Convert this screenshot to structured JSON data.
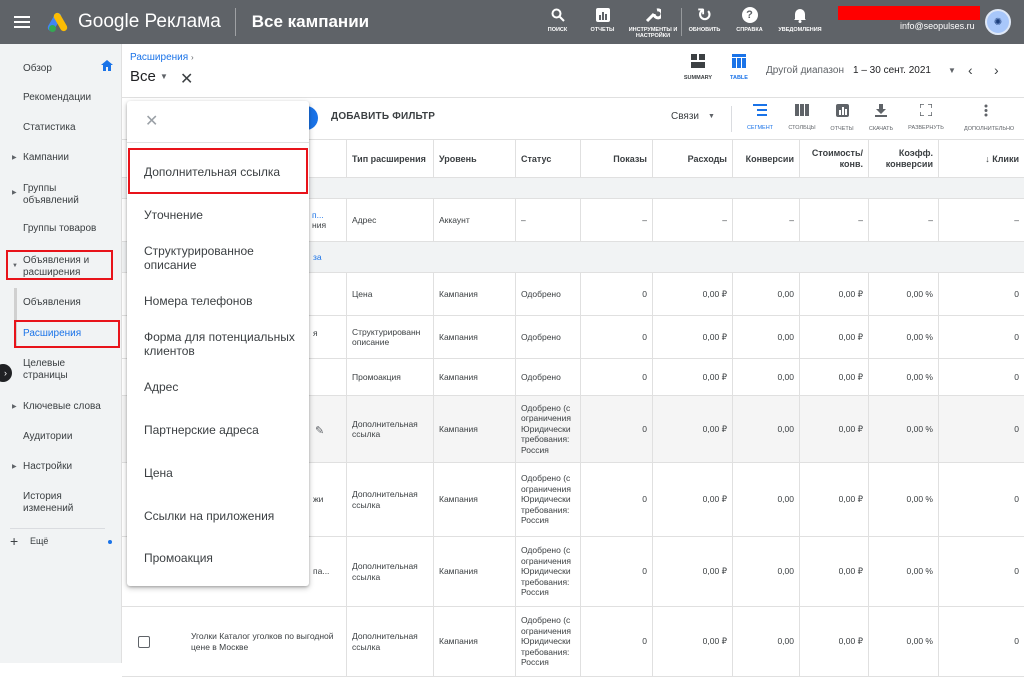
{
  "topbar": {
    "brand": "Google Реклама",
    "page_title": "Все кампании",
    "icons": [
      {
        "icon": "search-icon",
        "glyph": "🔍",
        "label": "ПОИСК"
      },
      {
        "icon": "reports-icon",
        "glyph": "▥",
        "label": "ОТЧЕТЫ"
      },
      {
        "icon": "wrench-icon",
        "glyph": "🔧",
        "label": "ИНСТРУМЕНТЫ И НАСТРОЙКИ"
      },
      {
        "icon": "refresh-icon",
        "glyph": "↻",
        "label": "ОБНОВИТЬ"
      },
      {
        "icon": "help-icon",
        "glyph": "?",
        "label": "СПРАВКА"
      },
      {
        "icon": "bell-icon",
        "glyph": "🔔",
        "label": "УВЕДОМЛЕНИЯ"
      }
    ],
    "email": "info@seopulses.ru",
    "avatar": "✺"
  },
  "sidebar": {
    "overview": "Обзор",
    "recommendations": "Рекомендации",
    "statistics": "Статистика",
    "campaigns": "Кампании",
    "ad_groups": "Группы объявлений",
    "product_groups": "Группы товаров",
    "ads_and_extensions": "Объявления и расширения",
    "ads": "Объявления",
    "extensions": "Расширения",
    "landing_pages": "Целевые страницы",
    "keywords": "Ключевые слова",
    "audiences": "Аудитории",
    "settings": "Настройки",
    "change_history": "История изменений",
    "more": "Ещё"
  },
  "header": {
    "breadcrumb": "Расширения",
    "scope": "Все",
    "summary_label": "SUMMARY",
    "table_label": "TABLE",
    "range_label": "Другой диапазон",
    "range_value": "1 – 30 сент. 2021"
  },
  "toolbar": {
    "add_filter": "ДОБАВИТЬ ФИЛЬТР",
    "links": "Связи",
    "segment": "СЕГМЕНТ",
    "columns": "СТОЛБЦЫ",
    "reports": "ОТЧЕТЫ",
    "download": "СКАЧАТЬ",
    "expand": "РАЗВЕРНУТЬ",
    "more": "ДОПОЛНИТЕЛЬНО"
  },
  "table": {
    "headers": {
      "type": "Тип расширения",
      "level": "Уровень",
      "status": "Статус",
      "impressions": "Показы",
      "cost": "Расходы",
      "conversions": "Конверсии",
      "cost_per_conv": "Стоимость/ конв.",
      "conv_rate": "Коэфф. конверсии",
      "clicks": "↓ Клики"
    },
    "row1": {
      "partial_link": "п...",
      "partial_link2": "ния",
      "type": "Адрес",
      "level": "Аккаунт",
      "status": "–",
      "impressions": "–",
      "cost": "–",
      "conversions": "–",
      "cost_per_conv": "–",
      "conv_rate": "–",
      "clicks": "–"
    },
    "row1b": {
      "partial_link": "за"
    },
    "rows": [
      {
        "partial": "",
        "type": "Цена",
        "level": "Кампания",
        "status": "Одобрено",
        "impressions": "0",
        "cost": "0,00 ₽",
        "conversions": "0,00",
        "cost_per_conv": "0,00 ₽",
        "conv_rate": "0,00 %",
        "clicks": "0"
      },
      {
        "partial": "я",
        "type": "Структурированн описание",
        "level": "Кампания",
        "status": "Одобрено",
        "impressions": "0",
        "cost": "0,00 ₽",
        "conversions": "0,00",
        "cost_per_conv": "0,00 ₽",
        "conv_rate": "0,00 %",
        "clicks": "0"
      },
      {
        "partial": "",
        "type": "Промоакция",
        "level": "Кампания",
        "status": "Одобрено",
        "impressions": "0",
        "cost": "0,00 ₽",
        "conversions": "0,00",
        "cost_per_conv": "0,00 ₽",
        "conv_rate": "0,00 %",
        "clicks": "0"
      },
      {
        "partial": "",
        "type": "Дополнительная ссылка",
        "level": "Кампания",
        "status": "Одобрено (с ограничения Юридически требования: Россия",
        "impressions": "0",
        "cost": "0,00 ₽",
        "conversions": "0,00",
        "cost_per_conv": "0,00 ₽",
        "conv_rate": "0,00 %",
        "clicks": "0"
      },
      {
        "partial": "жи",
        "type": "Дополнительная ссылка",
        "level": "Кампания",
        "status": "Одобрено (с ограничения Юридически требования: Россия",
        "impressions": "0",
        "cost": "0,00 ₽",
        "conversions": "0,00",
        "cost_per_conv": "0,00 ₽",
        "conv_rate": "0,00 %",
        "clicks": "0"
      },
      {
        "partial": "па...",
        "type": "Дополнительная ссылка",
        "level": "Кампания",
        "status": "Одобрено (с ограничения Юридически требования: Россия",
        "impressions": "0",
        "cost": "0,00 ₽",
        "conversions": "0,00",
        "cost_per_conv": "0,00 ₽",
        "conv_rate": "0,00 %",
        "clicks": "0"
      },
      {
        "partial": "",
        "type": "Дополнительная ссылка",
        "level": "Кампания",
        "status": "Одобрено (с ограничения Юридически требования: Россия",
        "impressions": "0",
        "cost": "0,00 ₽",
        "conversions": "0,00",
        "cost_per_conv": "0,00 ₽",
        "conv_rate": "0,00 %",
        "clicks": "0"
      }
    ],
    "last_row_name": "Уголки Каталог уголков по выгодной цене в Москве"
  },
  "dropdown": {
    "items": [
      "Дополнительная ссылка",
      "Уточнение",
      "Структурированное описание",
      "Номера телефонов",
      "Форма для потенциальных клиентов",
      "Адрес",
      "Партнерские адреса",
      "Цена",
      "Ссылки на приложения",
      "Промоакция"
    ]
  }
}
